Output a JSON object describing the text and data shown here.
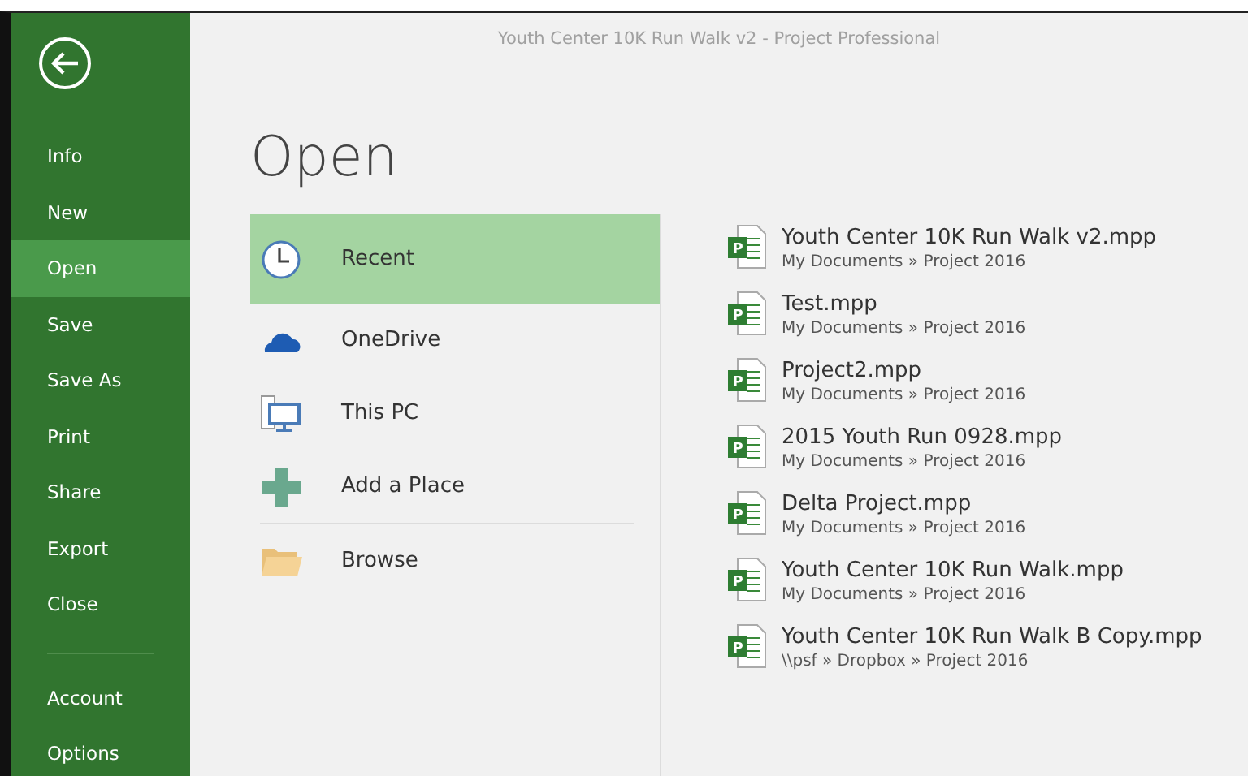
{
  "window": {
    "title": "Youth Center 10K Run Walk v2 - Project Professional"
  },
  "sidebar": {
    "items": [
      {
        "label": "Info",
        "selected": false
      },
      {
        "label": "New",
        "selected": false
      },
      {
        "label": "Open",
        "selected": true
      },
      {
        "label": "Save",
        "selected": false
      },
      {
        "label": "Save As",
        "selected": false
      },
      {
        "label": "Print",
        "selected": false
      },
      {
        "label": "Share",
        "selected": false
      },
      {
        "label": "Export",
        "selected": false
      },
      {
        "label": "Close",
        "selected": false
      }
    ],
    "bottom_items": [
      {
        "label": "Account",
        "selected": false
      },
      {
        "label": "Options",
        "selected": false
      }
    ]
  },
  "heading": "Open",
  "places": [
    {
      "label": "Recent",
      "kind": "clock",
      "selected": true
    },
    {
      "label": "OneDrive",
      "kind": "cloud",
      "selected": false
    },
    {
      "label": "This PC",
      "kind": "computer",
      "selected": false
    },
    {
      "label": "Add a Place",
      "kind": "plus",
      "selected": false
    }
  ],
  "more_places": [
    {
      "label": "Browse",
      "kind": "folder",
      "selected": false
    }
  ],
  "recent_files": [
    {
      "icon_letter": "P",
      "name": "Youth Center 10K Run Walk v2.mpp",
      "path": "My Documents » Project 2016"
    },
    {
      "icon_letter": "P",
      "name": "Test.mpp",
      "path": "My Documents » Project 2016"
    },
    {
      "icon_letter": "P",
      "name": "Project2.mpp",
      "path": "My Documents » Project 2016"
    },
    {
      "icon_letter": "P",
      "name": "2015 Youth Run 0928.mpp",
      "path": "My Documents » Project 2016"
    },
    {
      "icon_letter": "P",
      "name": "Delta Project.mpp",
      "path": "My Documents » Project 2016"
    },
    {
      "icon_letter": "P",
      "name": "Youth Center 10K Run Walk.mpp",
      "path": "My Documents » Project 2016"
    },
    {
      "icon_letter": "P",
      "name": "Youth Center 10K Run Walk B Copy.mpp",
      "path": "\\\\psf » Dropbox » Project 2016"
    }
  ]
}
